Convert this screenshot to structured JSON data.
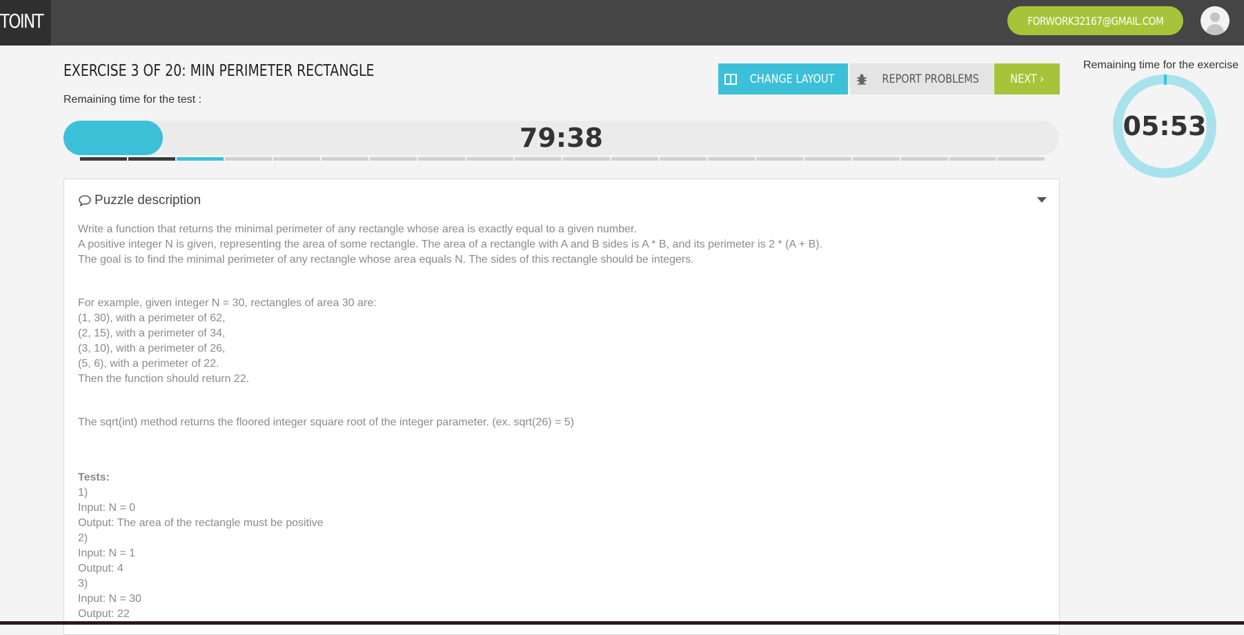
{
  "header": {
    "logo_text": "TOINT",
    "user_email": "FORWORK32167@GMAIL.COM"
  },
  "exercise": {
    "title": "EXERCISE 3 OF 20: MIN PERIMETER RECTANGLE",
    "current": 3,
    "total": 20,
    "remaining_test_label": "Remaining time for the test :",
    "test_timer": "79:38",
    "test_time_fraction": 0.1
  },
  "toolbar": {
    "change_layout_label": "CHANGE LAYOUT",
    "report_label": "REPORT PROBLEMS",
    "next_label": "NEXT ›"
  },
  "side_timer": {
    "label": "Remaining time for the exercise",
    "value": "05:53"
  },
  "puzzle": {
    "heading": "Puzzle description",
    "intro": [
      "Write a function that returns the minimal perimeter of any rectangle whose area is exactly equal to a given number.",
      "A positive integer N is given, representing the area of some rectangle. The area of a rectangle with A and B sides is A * B, and its perimeter is 2 * (A + B).",
      "The goal is to find the minimal perimeter of any rectangle whose area equals N. The sides of this rectangle should be integers."
    ],
    "example": [
      "For example, given integer N = 30, rectangles of area 30 are:",
      "(1, 30), with a perimeter of 62,",
      "(2, 15), with a perimeter of 34,",
      "(3, 10), with a perimeter of 26,",
      "(5, 6), with a perimeter of 22.",
      "Then the function should return 22."
    ],
    "note": "The sqrt(int) method returns the floored integer square root of the integer parameter. (ex. sqrt(26) = 5)",
    "tests_heading": "Tests:",
    "tests": [
      "1)",
      "Input: N = 0",
      "Output: The area of the rectangle must be positive",
      "2)",
      "Input: N = 1",
      "Output: 4",
      "3)",
      "Input: N = 30",
      "Output: 22"
    ]
  },
  "colors": {
    "accent_blue": "#3bc0d8",
    "accent_green": "#a6c43a",
    "topbar": "#454545"
  }
}
